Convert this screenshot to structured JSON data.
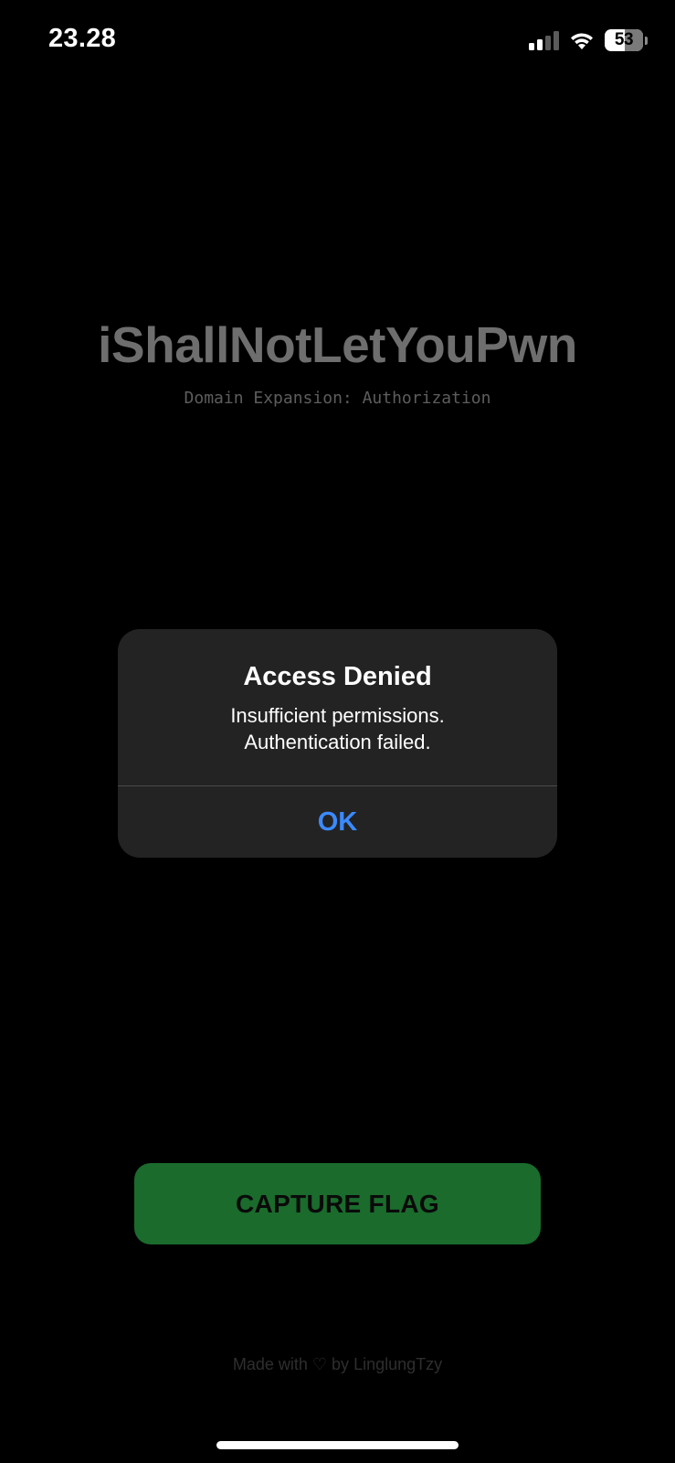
{
  "status_bar": {
    "time": "23.28",
    "battery_level": "53",
    "signal_bars_active": 2,
    "signal_bars_total": 4,
    "icons": [
      "signal-icon",
      "wifi-icon",
      "battery-icon"
    ]
  },
  "app": {
    "title": "iShallNotLetYouPwn",
    "subtitle": "Domain Expansion: Authorization"
  },
  "alert": {
    "title": "Access Denied",
    "message_line1": "Insufficient permissions.",
    "message_line2": "Authentication failed.",
    "ok_label": "OK"
  },
  "capture_button": {
    "label": "CAPTURE FLAG"
  },
  "footer": {
    "text": "Made with ♡ by LinglungTzy"
  },
  "colors": {
    "background": "#000000",
    "alert_background": "#232323",
    "alert_button": "#3b8aff",
    "capture_button": "#1a6b2c",
    "title": "#6e6e6e"
  }
}
